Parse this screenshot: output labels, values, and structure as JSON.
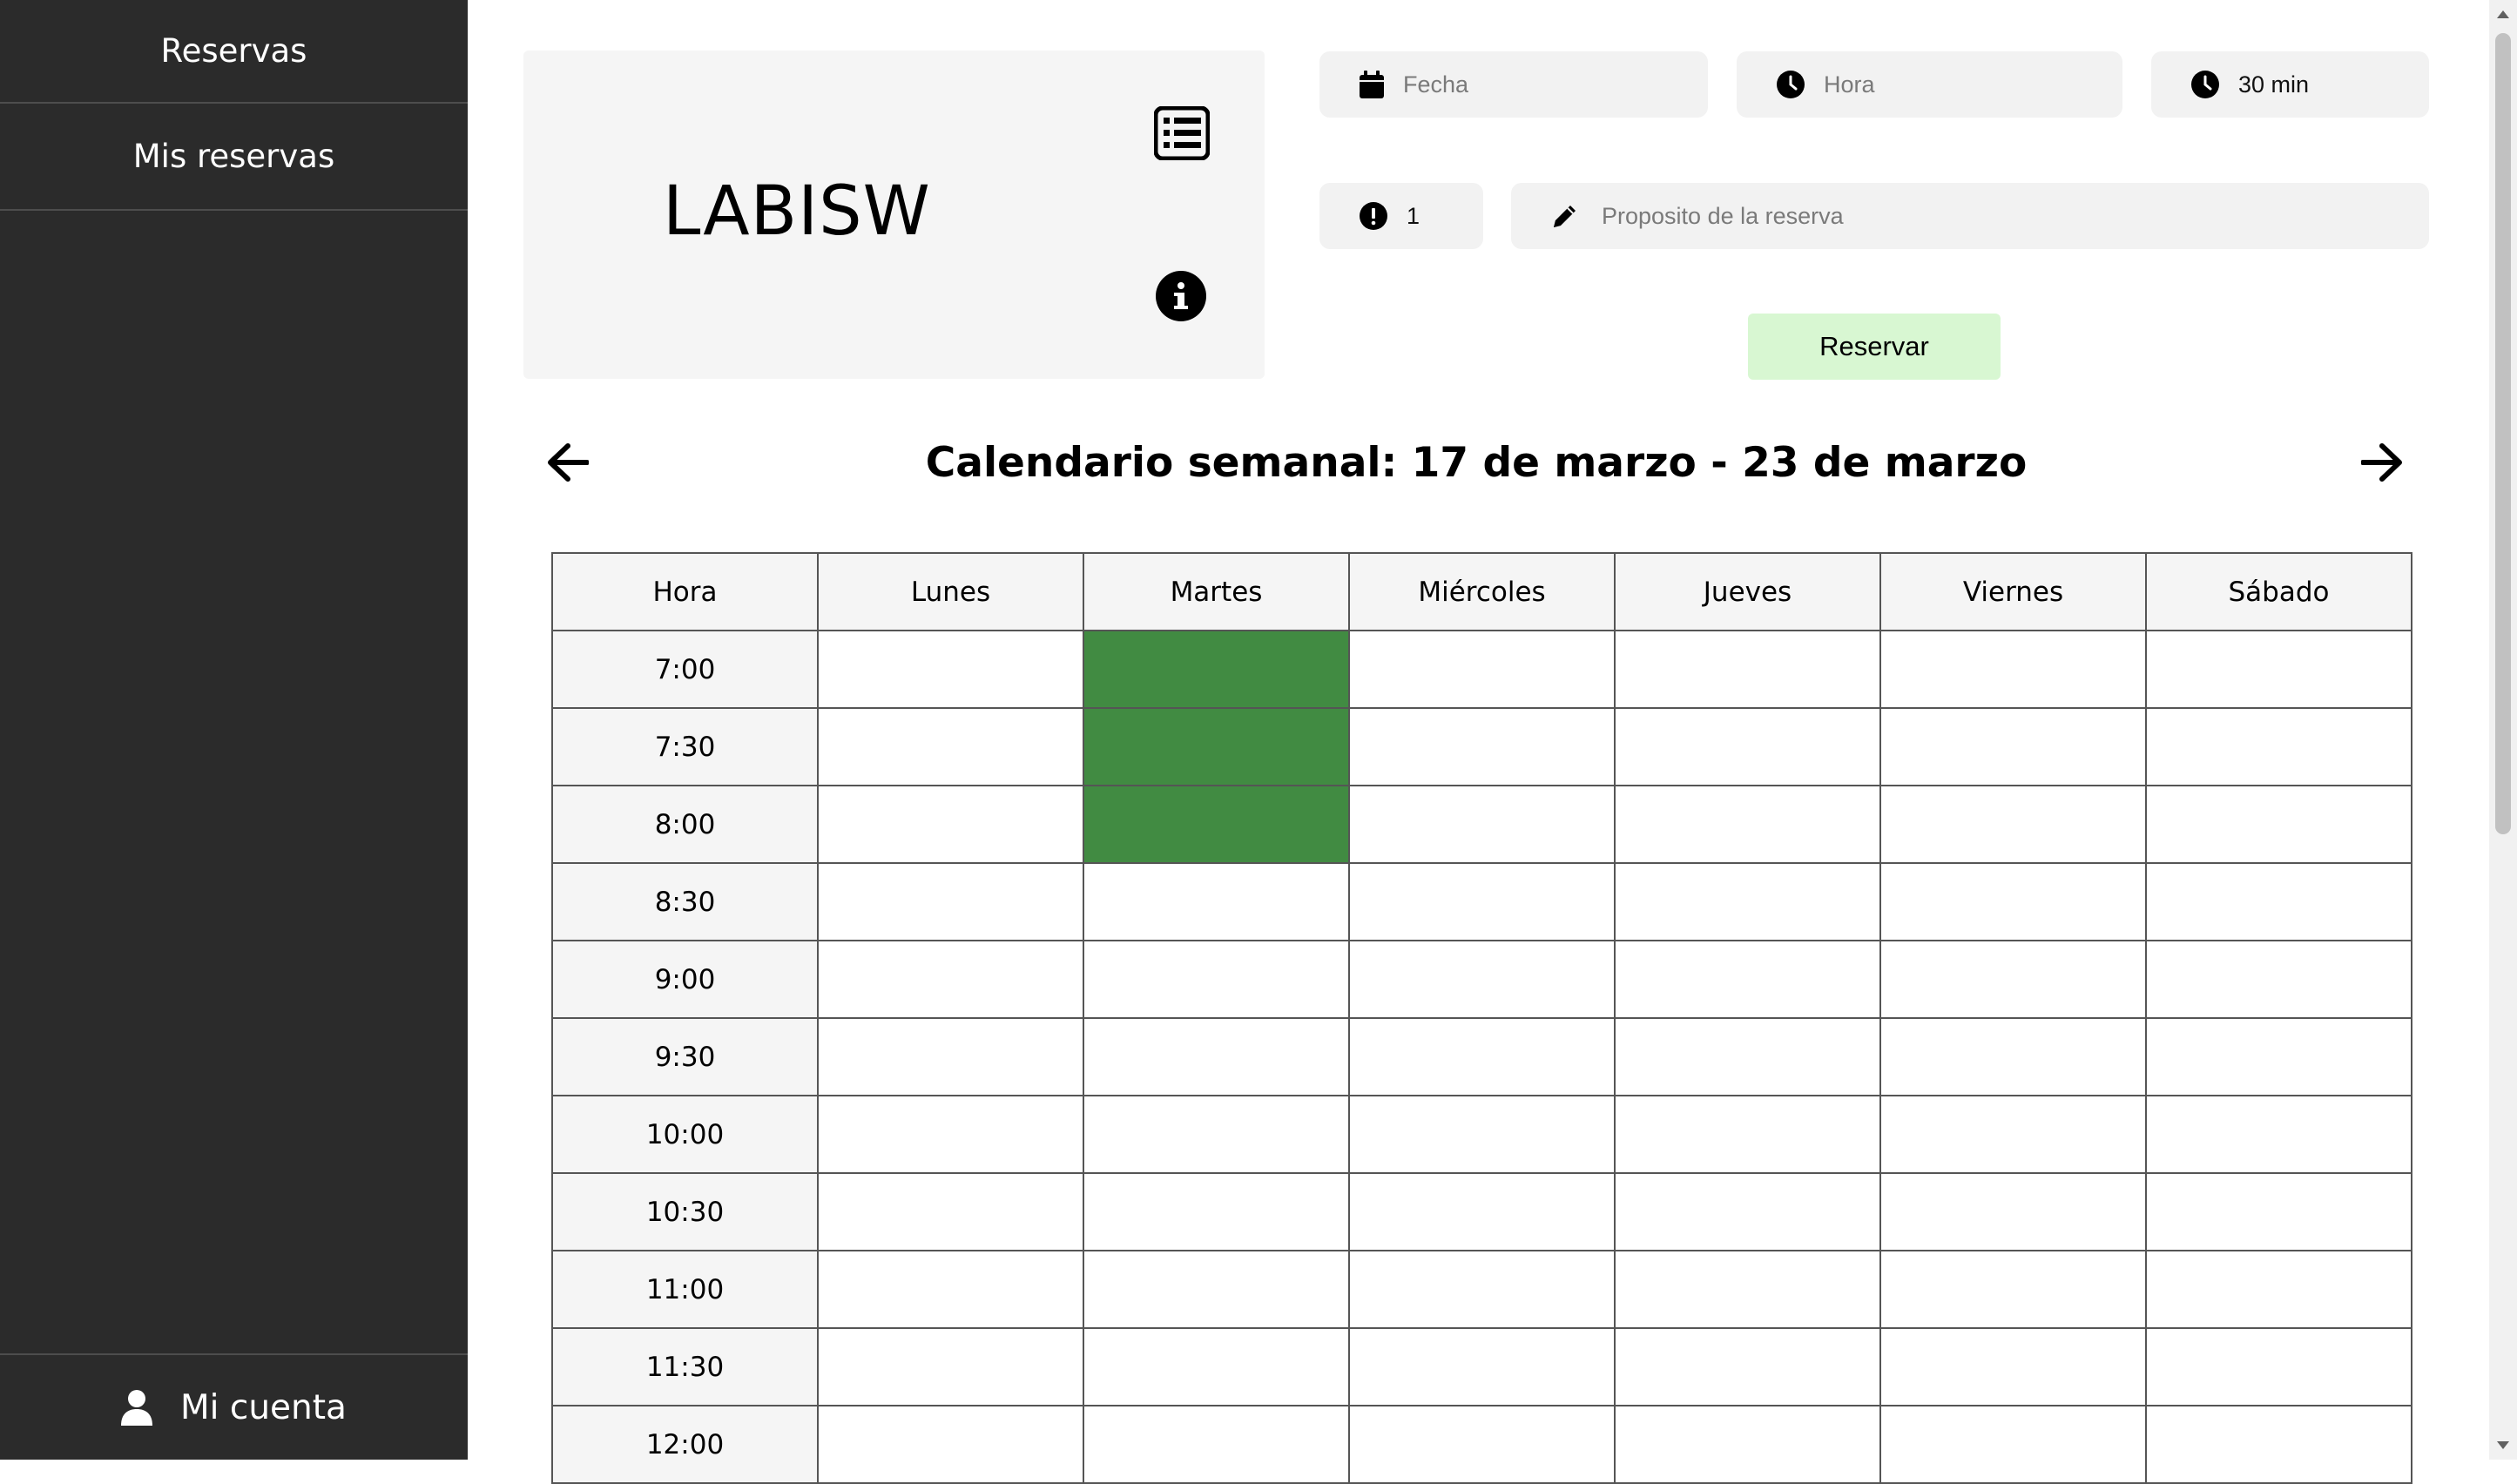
{
  "sidebar": {
    "items": [
      {
        "label": "Reservas"
      },
      {
        "label": "Mis reservas"
      }
    ],
    "account_label": "Mi cuenta"
  },
  "lab": {
    "name": "LABISW"
  },
  "form": {
    "fecha_placeholder": "Fecha",
    "hora_placeholder": "Hora",
    "duration_value": "30 min",
    "count_value": "1",
    "purpose_placeholder": "Proposito de la reserva",
    "reserve_label": "Reservar"
  },
  "calendar": {
    "title": "Calendario semanal: 17 de marzo - 23 de marzo",
    "columns": [
      "Hora",
      "Lunes",
      "Martes",
      "Miércoles",
      "Jueves",
      "Viernes",
      "Sábado"
    ],
    "hours": [
      "7:00",
      "7:30",
      "8:00",
      "8:30",
      "9:00",
      "9:30",
      "10:00",
      "10:30",
      "11:00",
      "11:30",
      "12:00"
    ],
    "booked_slots": [
      {
        "day": "Martes",
        "hour": "7:00"
      },
      {
        "day": "Martes",
        "hour": "7:30"
      },
      {
        "day": "Martes",
        "hour": "8:00"
      }
    ]
  },
  "colors": {
    "sidebar_bg": "#2b2b2b",
    "booked": "#418b42",
    "reserve_button": "#d8f7d2"
  },
  "icons": {
    "fecha": "calendar-icon",
    "hora": "clock-icon",
    "duration": "clock-icon",
    "count": "exclamation-circle-icon",
    "purpose": "pencil-icon",
    "list": "list-icon",
    "info": "info-icon",
    "account": "user-icon",
    "prev": "arrow-left-icon",
    "next": "arrow-right-icon"
  }
}
